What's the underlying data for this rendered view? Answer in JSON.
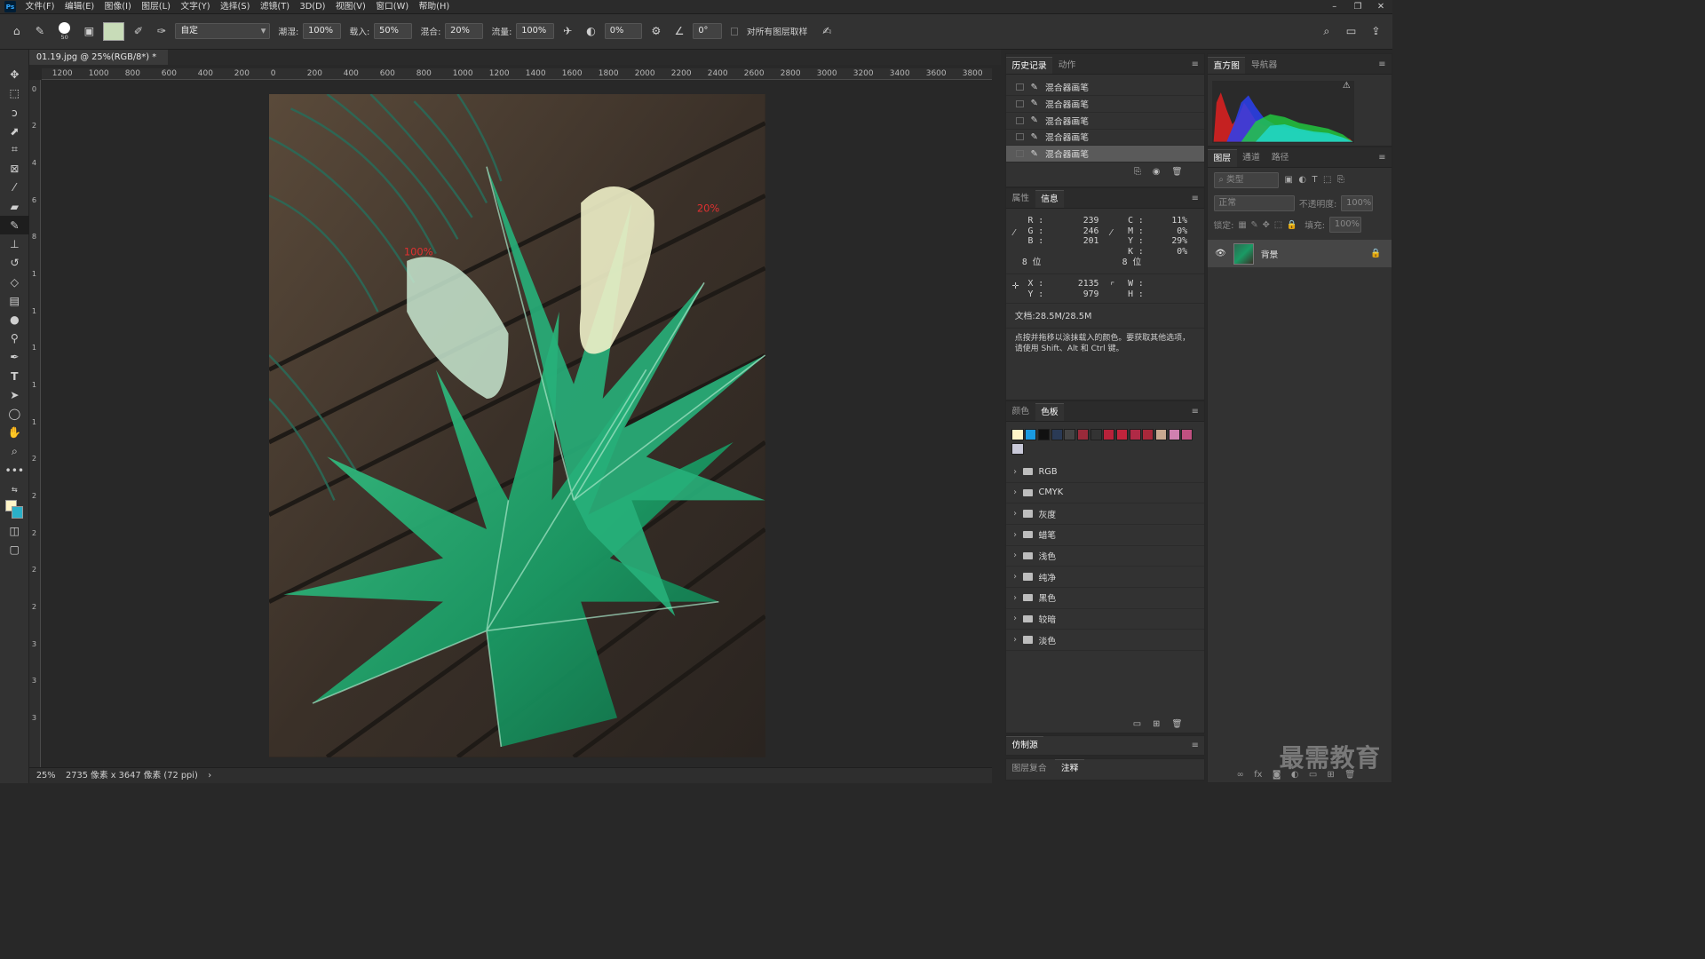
{
  "app": {
    "logo": "Ps"
  },
  "menu": [
    "文件(F)",
    "编辑(E)",
    "图像(I)",
    "图层(L)",
    "文字(Y)",
    "选择(S)",
    "滤镜(T)",
    "3D(D)",
    "视图(V)",
    "窗口(W)",
    "帮助(H)"
  ],
  "options": {
    "brush_size": "50",
    "preset": "自定",
    "wet_label": "潮湿:",
    "wet_value": "100%",
    "load_label": "载入:",
    "load_value": "50%",
    "mix_label": "混合:",
    "mix_value": "20%",
    "flow_label": "流量:",
    "flow_value": "100%",
    "smooth_value": "0%",
    "angle_value": "0°",
    "sample_all_label": "对所有图层取样"
  },
  "document": {
    "tab_title": "01.19.jpg @ 25%(RGB/8*) *",
    "ruler_h": [
      "1200",
      "1000",
      "800",
      "600",
      "400",
      "200",
      "0",
      "200",
      "400",
      "600",
      "800",
      "1000",
      "1200",
      "1400",
      "1600",
      "1800",
      "2000",
      "2200",
      "2400",
      "2600",
      "2800",
      "3000",
      "3200",
      "3400",
      "3600",
      "3800"
    ],
    "ruler_v": [
      "0",
      "2",
      "4",
      "6",
      "8",
      "1",
      "1",
      "1",
      "1",
      "1",
      "2",
      "2",
      "2",
      "2",
      "2",
      "3",
      "3",
      "3"
    ],
    "annotation_left": "100%",
    "annotation_right": "20%"
  },
  "status": {
    "zoom": "25%",
    "info": "2735 像素 x 3647 像素 (72 ppi)"
  },
  "history": {
    "tabs": [
      "历史记录",
      "动作"
    ],
    "items": [
      "混合器画笔",
      "混合器画笔",
      "混合器画笔",
      "混合器画笔",
      "混合器画笔"
    ]
  },
  "info_panel": {
    "tabs": [
      "属性",
      "信息"
    ],
    "rgb_labels": [
      "R :",
      "G :",
      "B :"
    ],
    "rgb_values": [
      "239",
      "246",
      "201"
    ],
    "cmyk_labels": [
      "C :",
      "M :",
      "Y :",
      "K :"
    ],
    "cmyk_values": [
      "11%",
      "0%",
      "29%",
      "0%"
    ],
    "bits_left": "8 位",
    "bits_right": "8 位",
    "x_label": "X :",
    "x_value": "2135",
    "y_label": "Y :",
    "y_value": "979",
    "w_label": "W :",
    "h_label": "H :",
    "doc_size": "文档:28.5M/28.5M",
    "hint": "点按并拖移以涂抹载入的颜色。要获取其他选项，请使用 Shift、Alt 和 Ctrl 键。"
  },
  "swatches_panel": {
    "tabs": [
      "颜色",
      "色板"
    ],
    "colors": [
      "#fff5c8",
      "#1a9ae0",
      "#111111",
      "#2a3a55",
      "#444444",
      "#9a2a3a",
      "#333333",
      "#b8223a",
      "#c0243c",
      "#b02a46",
      "#a8283a",
      "#c8a890",
      "#d080b0",
      "#c05080",
      "#c8c8d8"
    ],
    "groups": [
      "RGB",
      "CMYK",
      "灰度",
      "蜡笔",
      "浅色",
      "纯净",
      "黑色",
      "较暗",
      "淡色"
    ]
  },
  "bottom_tabs": {
    "clone_source": "仿制源",
    "layer_comps": "图层复合",
    "notes": "注释"
  },
  "histogram": {
    "tabs": [
      "直方图",
      "导航器"
    ]
  },
  "layers": {
    "tabs": [
      "图层",
      "通道",
      "路径"
    ],
    "filter_placeholder": "类型",
    "blend_mode": "正常",
    "opacity_label": "不透明度:",
    "opacity_value": "100%",
    "lock_label": "锁定:",
    "fill_label": "填充:",
    "fill_value": "100%",
    "layer_name": "背景"
  },
  "watermark": "最需教育"
}
